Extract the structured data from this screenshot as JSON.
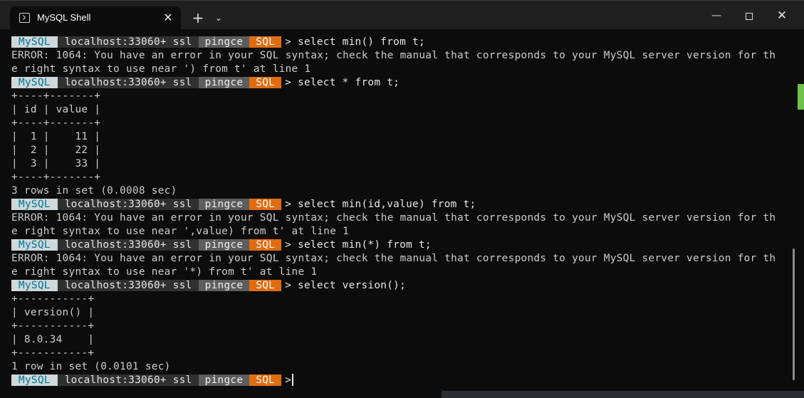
{
  "window": {
    "tab_title": "MySQL Shell",
    "new_tab_label": "+",
    "dropdown_label": "⌄",
    "close_tab_label": "✕",
    "minimize_label": "—",
    "close_label": "✕"
  },
  "prompt": {
    "mysql": "MySQL",
    "host": "localhost:33060+ ssl",
    "schema": "pingce",
    "mode": "SQL",
    "arrow": ">"
  },
  "terminal": {
    "lines": [
      {
        "type": "prompt",
        "command": "select min() from t;"
      },
      {
        "type": "text",
        "text": "ERROR: 1064: You have an error in your SQL syntax; check the manual that corresponds to your MySQL server version for th"
      },
      {
        "type": "text",
        "text": "e right syntax to use near ') from t' at line 1"
      },
      {
        "type": "prompt",
        "command": "select * from t;"
      },
      {
        "type": "text",
        "text": "+----+-------+"
      },
      {
        "type": "text",
        "text": "| id | value |"
      },
      {
        "type": "text",
        "text": "+----+-------+"
      },
      {
        "type": "text",
        "text": "|  1 |    11 |"
      },
      {
        "type": "text",
        "text": "|  2 |    22 |"
      },
      {
        "type": "text",
        "text": "|  3 |    33 |"
      },
      {
        "type": "text",
        "text": "+----+-------+"
      },
      {
        "type": "text",
        "text": "3 rows in set (0.0008 sec)"
      },
      {
        "type": "prompt",
        "command": "select min(id,value) from t;"
      },
      {
        "type": "text",
        "text": "ERROR: 1064: You have an error in your SQL syntax; check the manual that corresponds to your MySQL server version for th"
      },
      {
        "type": "text",
        "text": "e right syntax to use near ',value) from t' at line 1"
      },
      {
        "type": "prompt",
        "command": "select min(*) from t;"
      },
      {
        "type": "text",
        "text": "ERROR: 1064: You have an error in your SQL syntax; check the manual that corresponds to your MySQL server version for th"
      },
      {
        "type": "text",
        "text": "e right syntax to use near '*) from t' at line 1"
      },
      {
        "type": "prompt",
        "command": "select version();"
      },
      {
        "type": "text",
        "text": "+-----------+"
      },
      {
        "type": "text",
        "text": "| version() |"
      },
      {
        "type": "text",
        "text": "+-----------+"
      },
      {
        "type": "text",
        "text": "| 8.0.34    |"
      },
      {
        "type": "text",
        "text": "+-----------+"
      },
      {
        "type": "text",
        "text": "1 row in set (0.0101 sec)"
      },
      {
        "type": "prompt",
        "command": ""
      }
    ]
  }
}
